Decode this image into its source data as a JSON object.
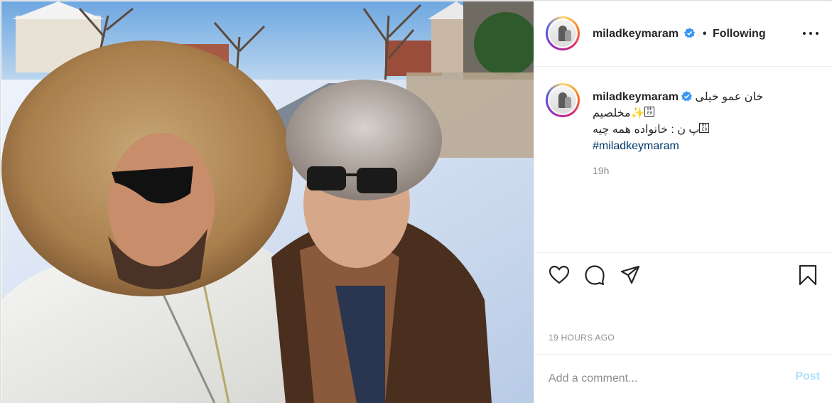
{
  "post": {
    "photo_alt": "",
    "icons": [
      "heart-icon",
      "comment-icon",
      "share-icon",
      "bookmark-icon",
      "verified-badge-icon",
      "more-options-icon"
    ]
  },
  "header": {
    "username": "miladkeymaram",
    "separator": "•",
    "follow_state": "Following"
  },
  "caption": {
    "username": "miladkeymaram",
    "line1": "خان عمو خیلی",
    "line2": "مخلصیم",
    "line3": "پ ن : خانواده همه چیه",
    "hashtag": "#miladkeymaram",
    "time": "19h"
  },
  "meta": {
    "posted_ago": "19 HOURS AGO"
  },
  "comment": {
    "placeholder": "Add a comment...",
    "post_label": "Post"
  },
  "colors": {
    "verified": "#3897f0",
    "link": "#00376b",
    "post_disabled": "#b2dffc",
    "muted": "#8e8e8e"
  }
}
